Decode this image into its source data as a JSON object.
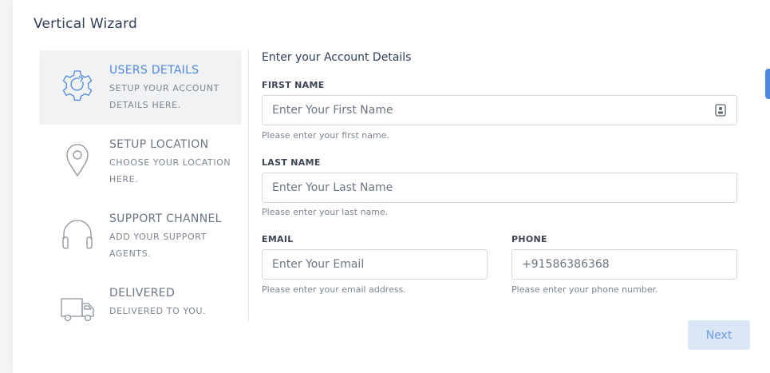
{
  "wizard": {
    "title": "Vertical Wizard"
  },
  "steps": [
    {
      "title": "USERS DETAILS",
      "subtitle": "SETUP YOUR ACCOUNT DETAILS HERE.",
      "icon": "gear-icon",
      "active": true
    },
    {
      "title": "SETUP LOCATION",
      "subtitle": "CHOOSE YOUR LOCATION HERE.",
      "icon": "location-pin-icon",
      "active": false
    },
    {
      "title": "SUPPORT CHANNEL",
      "subtitle": "ADD YOUR SUPPORT AGENTS.",
      "icon": "headphones-icon",
      "active": false
    },
    {
      "title": "DELIVERED",
      "subtitle": "DELIVERED TO YOU.",
      "icon": "truck-icon",
      "active": false
    }
  ],
  "form": {
    "section_title": "Enter your Account Details",
    "first_name": {
      "label": "FIRST NAME",
      "placeholder": "Enter Your First Name",
      "value": "",
      "help": "Please enter your first name."
    },
    "last_name": {
      "label": "LAST NAME",
      "placeholder": "Enter Your Last Name",
      "value": "",
      "help": "Please enter your last name."
    },
    "email": {
      "label": "EMAIL",
      "placeholder": "Enter Your Email",
      "value": "",
      "help": "Please enter your email address."
    },
    "phone": {
      "label": "PHONE",
      "placeholder": "+91586386368",
      "value": "",
      "help": "Please enter your phone number."
    }
  },
  "actions": {
    "next_label": "Next"
  },
  "colors": {
    "accent": "#4f88e0",
    "active_step_bg": "#f1f2f3",
    "next_button_bg": "#dbe6f7"
  }
}
